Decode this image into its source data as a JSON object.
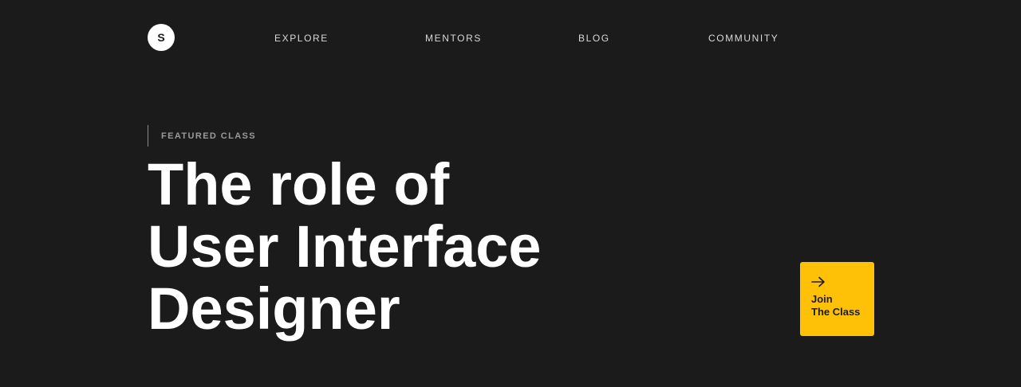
{
  "brand": {
    "logo_letter": "S"
  },
  "nav": {
    "items": [
      {
        "label": "EXPLORE"
      },
      {
        "label": "MENTORS"
      },
      {
        "label": "BLOG"
      },
      {
        "label": "COMMUNITY"
      }
    ]
  },
  "hero": {
    "eyebrow": "FEATURED CLASS",
    "title_lines": [
      "The role of",
      "User Interface",
      "Designer"
    ]
  },
  "cta": {
    "icon": "arrow-right-icon",
    "line1": "Join",
    "line2": "The Class",
    "color": "#ffc107"
  },
  "colors": {
    "background": "#1b1b1b",
    "text": "#ffffff",
    "accent": "#ffc107"
  }
}
